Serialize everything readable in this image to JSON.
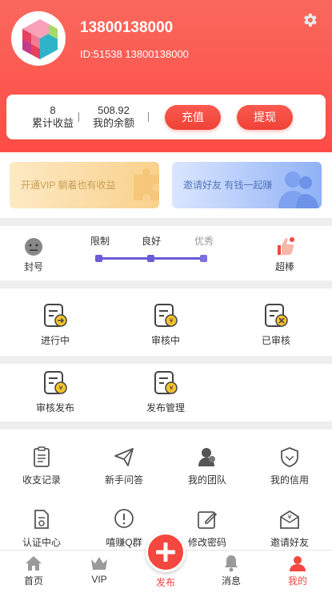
{
  "profile": {
    "phone": "13800138000",
    "id_line": "ID:51538 13800138000"
  },
  "stats": {
    "total_income_value": "8",
    "total_income_label": "累计收益",
    "balance_value": "508.92",
    "balance_label": "我的余额",
    "recharge_label": "充值",
    "withdraw_label": "提现"
  },
  "promos": {
    "vip_text": "开通VIP 躺着也有收益",
    "invite_text": "邀请好友 有钱一起赚"
  },
  "credit": {
    "left_label": "封号",
    "levels": [
      "限制",
      "良好",
      "优秀"
    ],
    "right_label": "超棒"
  },
  "orders": {
    "items": [
      {
        "label": "进行中"
      },
      {
        "label": "审核中"
      },
      {
        "label": "已审核"
      },
      {
        "label": "审核发布"
      },
      {
        "label": "发布管理"
      }
    ]
  },
  "tools": {
    "items": [
      {
        "label": "收支记录"
      },
      {
        "label": "新手问答"
      },
      {
        "label": "我的团队"
      },
      {
        "label": "我的信用"
      },
      {
        "label": "认证中心"
      },
      {
        "label": "嘻赚Q群"
      },
      {
        "label": "修改密码"
      },
      {
        "label": "邀请好友"
      }
    ]
  },
  "nav": {
    "items": [
      {
        "label": "首页"
      },
      {
        "label": "VIP"
      },
      {
        "label": "发布"
      },
      {
        "label": "消息"
      },
      {
        "label": "我的"
      }
    ]
  },
  "colors": {
    "accent": "#f3473f",
    "header_top": "#f9685d",
    "header_bottom": "#ff4b45",
    "slider": "#6b5bd6"
  }
}
